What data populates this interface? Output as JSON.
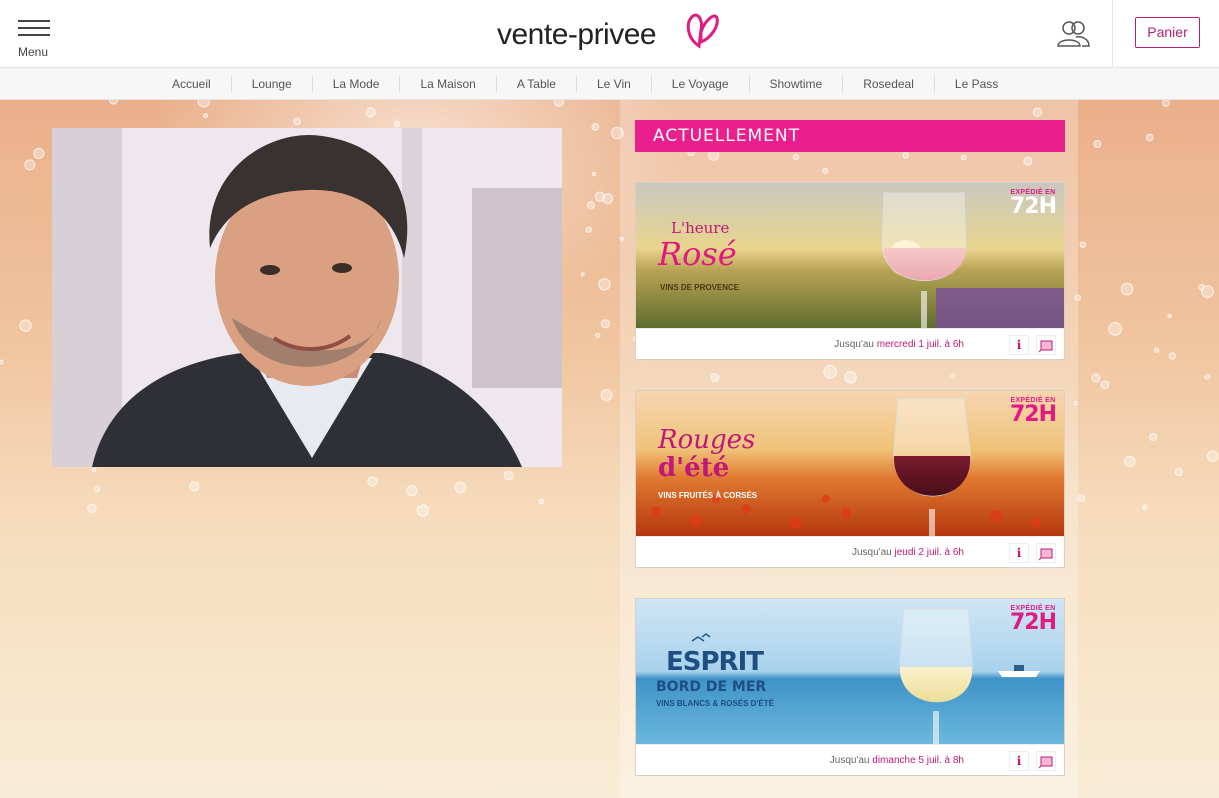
{
  "header": {
    "menu_label": "Menu",
    "logo_text": "vente-privee",
    "cart_label": "Panier"
  },
  "nav": {
    "items": [
      "Accueil",
      "Lounge",
      "La Mode",
      "La Maison",
      "A Table",
      "Le Vin",
      "Le Voyage",
      "Showtime",
      "Rosedeal",
      "Le Pass"
    ]
  },
  "main": {
    "section_title": "ACTUELLEMENT",
    "sales": [
      {
        "title_line1": "L'heure",
        "title_line2": "Rosé",
        "subtitle": "VINS DE PROVENCE",
        "badge_top": "EXPÉDIÉ EN",
        "badge_main": "72H",
        "date_prefix": "Jusqu'au",
        "date_value": "mercredi 1 juil. à 6h",
        "info_label": "i"
      },
      {
        "title_line1": "Rouges",
        "title_line2": "d'été",
        "subtitle": "VINS FRUITÉS À CORSÉS",
        "badge_top": "EXPÉDIÉ EN",
        "badge_main": "72H",
        "date_prefix": "Jusqu'au",
        "date_value": "jeudi 2 juil. à 6h",
        "info_label": "i"
      },
      {
        "title_line1": "ESPRIT",
        "title_line2": "BORD DE MER",
        "subtitle": "VINS BLANCS & ROSÉS D'ÉTÉ",
        "badge_top": "EXPÉDIÉ EN",
        "badge_main": "72H",
        "date_prefix": "Jusqu'au",
        "date_value": "dimanche 5 juil. à 8h",
        "info_label": "i"
      }
    ]
  },
  "colors": {
    "brand_pink": "#ea1f8e",
    "accent_magenta": "#b51f77",
    "date_highlight": "#c0187a"
  },
  "icons": {
    "menu": "hamburger-icon",
    "logo_mark": "butterfly-icon",
    "account": "users-icon",
    "share": "share-icon"
  }
}
